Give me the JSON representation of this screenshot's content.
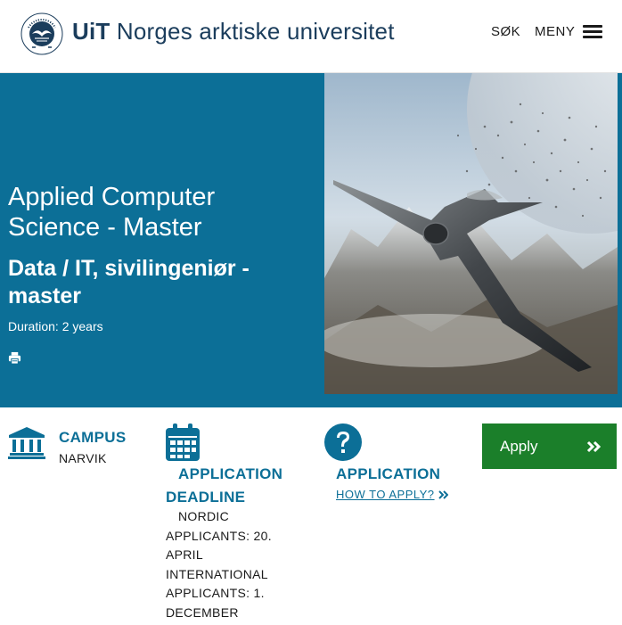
{
  "header": {
    "logo_name": "UiT seal",
    "brand_bold": "UiT",
    "brand_rest": " Norges arktiske universitet",
    "search_label": "SØK",
    "menu_label": "MENY"
  },
  "hero": {
    "title": "Applied Computer Science - Master",
    "subtitle": "Data / IT, sivilingeniør - master",
    "duration": "Duration: 2 years",
    "print_icon": "print-icon",
    "image_description": "jet-fighter-mountains"
  },
  "info": {
    "campus": {
      "icon": "institution-icon",
      "heading": "CAMPUS",
      "value": "NARVIK"
    },
    "deadline": {
      "icon": "calendar-icon",
      "heading": "APPLICATION DEADLINE",
      "lines": [
        "NORDIC APPLICANTS: 20. APRIL",
        "INTERNATIONAL APPLICANTS: 1. DECEMBER"
      ]
    },
    "application": {
      "icon": "question-circle-icon",
      "heading": "APPLICATION",
      "link": "HOW TO APPLY?"
    }
  },
  "apply_button": {
    "label": "Apply",
    "icon": "double-chevron-right-icon"
  },
  "colors": {
    "primary": "#0c6f97",
    "brand": "#1b3d5c",
    "apply": "#1b7f2a"
  }
}
